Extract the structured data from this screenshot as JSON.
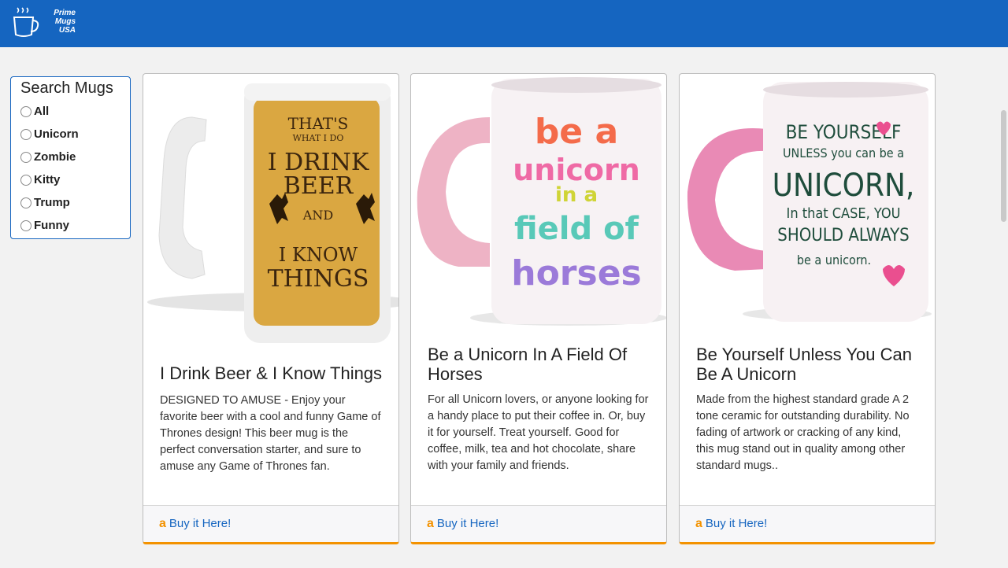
{
  "brand": {
    "logo_icon": "coffee-cup-icon",
    "line1": "Prime",
    "line2": "Mugs",
    "line3": "USA"
  },
  "colors": {
    "header": "#1565c0",
    "accent": "#f39200",
    "link": "#1565c0"
  },
  "search": {
    "title": "Search Mugs",
    "options": [
      "All",
      "Unicorn",
      "Zombie",
      "Kitty",
      "Trump",
      "Funny"
    ]
  },
  "products": [
    {
      "image_text": [
        "THAT'S",
        "WHAT I DO",
        "I DRINK",
        "BEER",
        "AND",
        "I KNOW",
        "THINGS"
      ],
      "title": "I Drink Beer & I Know Things",
      "description": "DESIGNED TO AMUSE - Enjoy your favorite beer with a cool and funny Game of Thrones design! This beer mug is the perfect conversation starter, and sure to amuse any Game of Thrones fan.",
      "buy_label": "Buy it Here!",
      "icon": "amazon-icon"
    },
    {
      "image_text": [
        "be a",
        "unicorn",
        "in a",
        "field of",
        "horses"
      ],
      "title": "Be a Unicorn In A Field Of Horses",
      "description": "For all Unicorn lovers, or anyone looking for a handy place to put their coffee in. Or, buy it for yourself. Treat yourself. Good for coffee, milk, tea and hot chocolate, share with your family and friends.",
      "buy_label": "Buy it Here!",
      "icon": "amazon-icon"
    },
    {
      "image_text": [
        "BE YOURSELF",
        "UNLESS you can be a",
        "UNICORN,",
        "In that CASE, YOU",
        "SHOULD ALWAYS",
        "be a unicorn."
      ],
      "title": "Be Yourself Unless You Can Be A Unicorn",
      "description": "Made from the highest standard grade A 2 tone ceramic for outstanding durability. No fading of artwork or cracking of any kind, this mug stand out in quality among other standard mugs..",
      "buy_label": "Buy it Here!",
      "icon": "amazon-icon"
    }
  ]
}
